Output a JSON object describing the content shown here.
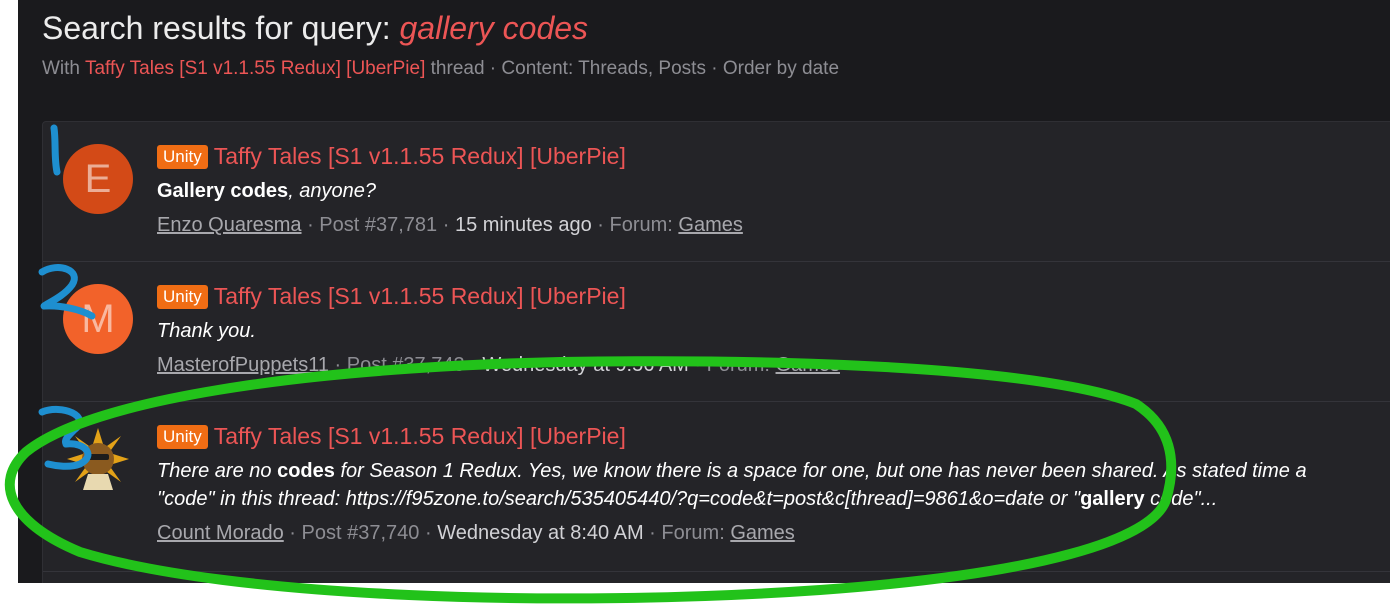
{
  "header": {
    "title_prefix": "Search results for query: ",
    "query": "gallery codes",
    "subtitle_with": "With ",
    "thread_name": "Taffy Tales [S1 v1.1.55 Redux] [UberPie]",
    "subtitle_rest": " thread · Content: Threads, Posts · Order by date"
  },
  "results": [
    {
      "avatar_letter": "E",
      "prefix": "Unity",
      "thread": "Taffy Tales [S1 v1.1.55 Redux] [UberPie]",
      "snippet": {
        "bold": "Gallery codes",
        "rest": ", anyone?"
      },
      "user": "Enzo Quaresma",
      "post": "Post #37,781",
      "time": "15 minutes ago",
      "forum_label": "Forum: ",
      "forum": "Games"
    },
    {
      "avatar_letter": "M",
      "prefix": "Unity",
      "thread": "Taffy Tales [S1 v1.1.55 Redux] [UberPie]",
      "snippet": {
        "text": "Thank you."
      },
      "user": "MasterofPuppets11",
      "post": "Post #37,743",
      "time": "Wednesday at 9:56 AM",
      "forum_label": "Forum: ",
      "forum": "Games"
    },
    {
      "avatar_letter": "",
      "prefix": "Unity",
      "thread": "Taffy Tales [S1 v1.1.55 Redux] [UberPie]",
      "snippet": {
        "l1_a": "There are no ",
        "l1_bold": "codes",
        "l1_b": " for Season 1 Redux. Yes, we know there is a space for one, but one has never been shared. As stated time a",
        "l2_a": "\"code\" in this thread: https://f95zone.to/search/535405440/?q=code&t=post&c[thread]=9861&o=date or \"",
        "l2_bold": "gallery",
        "l2_b": " code\"..."
      },
      "user": "Count Morado",
      "post": "Post #37,740",
      "time": "Wednesday at 8:40 AM",
      "forum_label": "Forum: ",
      "forum": "Games"
    }
  ],
  "colors": {
    "background": "#1a1a1d",
    "link": "#ec5555",
    "prefix_badge": "#f06d14",
    "annotation_blue": "#1e8fd0",
    "annotation_green": "#22c21a"
  }
}
